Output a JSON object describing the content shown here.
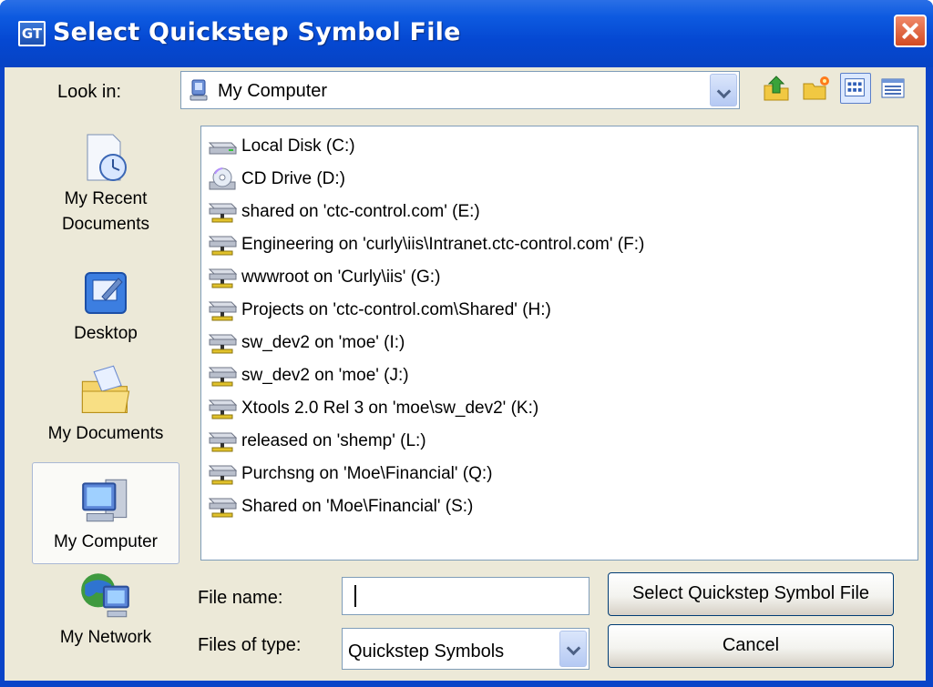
{
  "window": {
    "title": "Select Quickstep Symbol File",
    "app_icon_text": "GT"
  },
  "lookin": {
    "label": "Look in:",
    "value": "My Computer"
  },
  "toolbar": {
    "buttons": [
      "up-one-level-icon",
      "create-new-folder-icon",
      "list-view-icon",
      "details-view-icon"
    ]
  },
  "places": [
    {
      "label_line1": "My Recent",
      "label_line2": "Documents",
      "icon": "recent-documents-icon"
    },
    {
      "label_line1": "Desktop",
      "icon": "desktop-icon"
    },
    {
      "label_line1": "My Documents",
      "icon": "my-documents-icon"
    },
    {
      "label_line1": "My Computer",
      "icon": "my-computer-icon",
      "selected": true
    },
    {
      "label_line1": "My Network",
      "icon": "my-network-icon"
    }
  ],
  "files": [
    {
      "label": "Local Disk (C:)",
      "icon": "hard-disk-icon"
    },
    {
      "label": "CD Drive (D:)",
      "icon": "cd-drive-icon"
    },
    {
      "label": "shared on 'ctc-control.com' (E:)",
      "icon": "network-drive-icon"
    },
    {
      "label": "Engineering on 'curly\\iis\\Intranet.ctc-control.com' (F:)",
      "icon": "network-drive-icon"
    },
    {
      "label": "wwwroot on 'Curly\\iis' (G:)",
      "icon": "network-drive-icon"
    },
    {
      "label": "Projects on 'ctc-control.com\\Shared' (H:)",
      "icon": "network-drive-icon"
    },
    {
      "label": "sw_dev2 on 'moe' (I:)",
      "icon": "network-drive-icon"
    },
    {
      "label": "sw_dev2 on 'moe' (J:)",
      "icon": "network-drive-icon"
    },
    {
      "label": "Xtools 2.0 Rel 3 on 'moe\\sw_dev2' (K:)",
      "icon": "network-drive-icon"
    },
    {
      "label": "released on 'shemp' (L:)",
      "icon": "network-drive-icon"
    },
    {
      "label": "Purchsng on 'Moe\\Financial' (Q:)",
      "icon": "network-drive-icon"
    },
    {
      "label": "Shared on 'Moe\\Financial' (S:)",
      "icon": "network-drive-icon"
    }
  ],
  "filename": {
    "label": "File name:",
    "value": ""
  },
  "filetype": {
    "label": "Files of type:",
    "value": "Quickstep Symbols"
  },
  "buttons": {
    "select": "Select Quickstep Symbol File",
    "cancel": "Cancel"
  },
  "colors": {
    "title_bar": "#0548d2",
    "dialog_bg": "#ece9d8",
    "border": "#7f9db9"
  }
}
